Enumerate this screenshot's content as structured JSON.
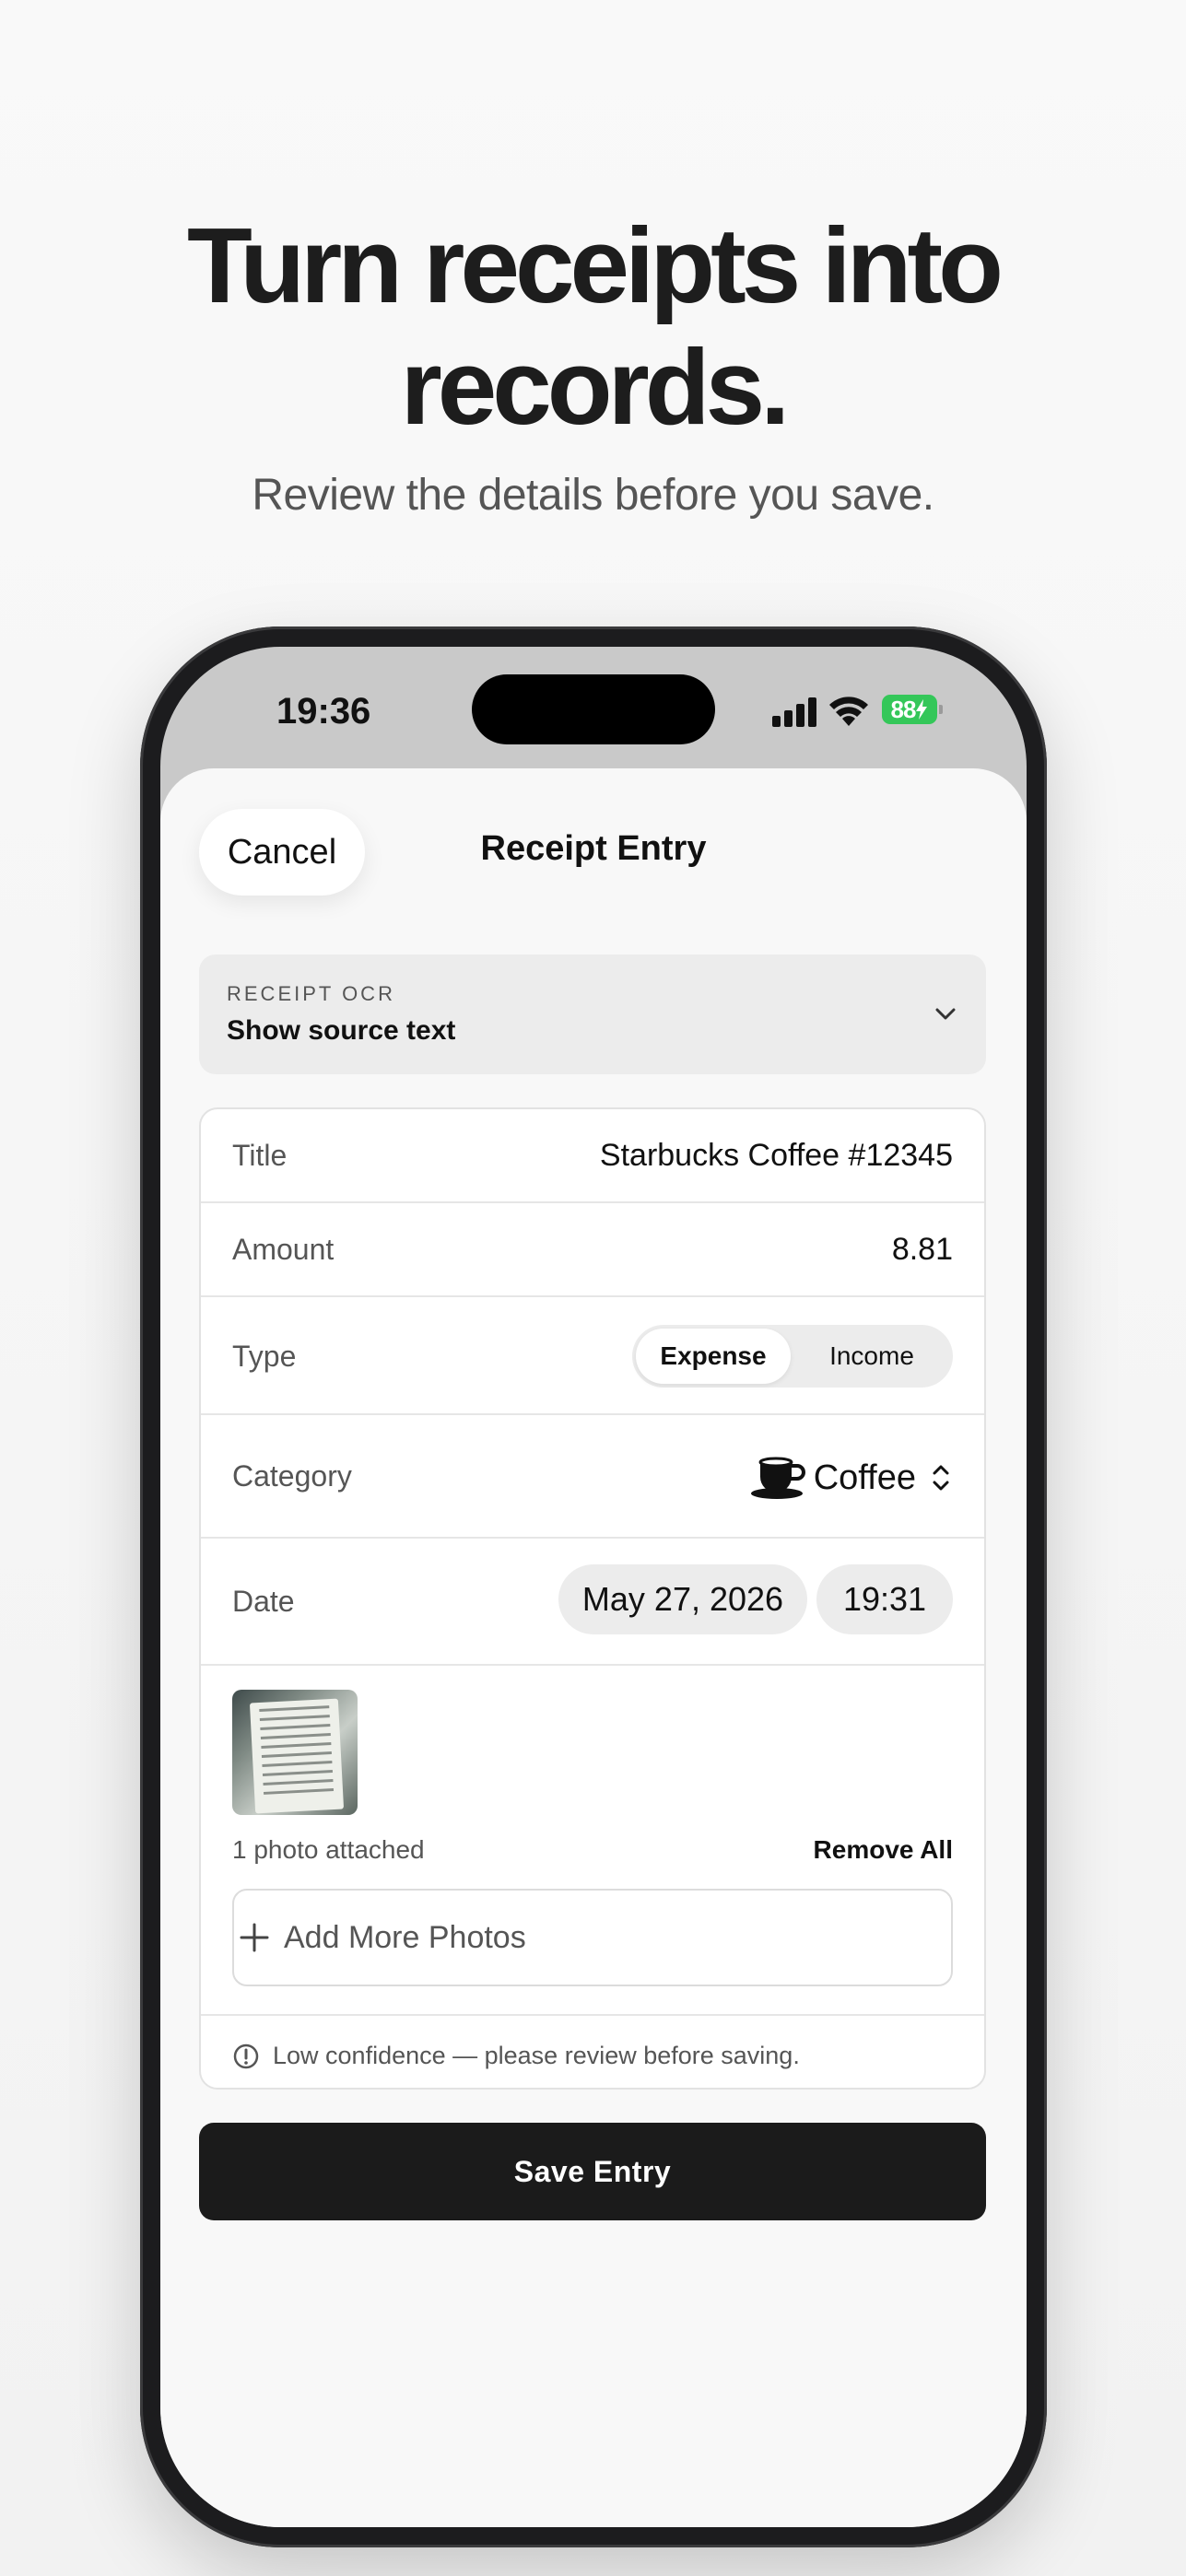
{
  "hero": {
    "title_line1": "Turn receipts into",
    "title_line2": "records.",
    "subtitle": "Review the details before you save."
  },
  "status_bar": {
    "time": "19:36",
    "battery": "88"
  },
  "nav": {
    "cancel_label": "Cancel",
    "title": "Receipt Entry"
  },
  "ocr": {
    "eyebrow": "RECEIPT OCR",
    "label": "Show source text"
  },
  "form": {
    "title_label": "Title",
    "title_value": "Starbucks Coffee #12345",
    "amount_label": "Amount",
    "amount_value": "8.81",
    "type_label": "Type",
    "type_options": [
      "Expense",
      "Income"
    ],
    "type_selected": "Expense",
    "category_label": "Category",
    "category_icon": "coffee-cup-icon",
    "category_value": "Coffee",
    "date_label": "Date",
    "date_value": "May 27, 2026",
    "time_value": "19:31"
  },
  "photos": {
    "count_text": "1 photo attached",
    "remove_all_label": "Remove All",
    "add_more_label": "Add More Photos"
  },
  "warning": {
    "text": "Low confidence — please review before saving."
  },
  "actions": {
    "save_label": "Save Entry"
  },
  "colors": {
    "accent_dark": "#1b1b1b",
    "battery_green": "#34c759",
    "background": "#f8f8f8"
  }
}
